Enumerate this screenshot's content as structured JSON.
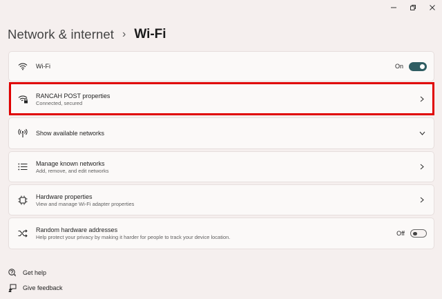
{
  "window": {
    "controls": {
      "minimize_icon": "minimize-icon",
      "restore_icon": "restore-icon",
      "close_icon": "close-icon"
    }
  },
  "breadcrumb": {
    "parent": "Network & internet",
    "separator": "›",
    "current": "Wi-Fi"
  },
  "rows": {
    "wifi": {
      "title": "Wi-Fi",
      "state": "On",
      "icon": "wifi-icon",
      "on": true
    },
    "properties": {
      "title": "RANCAH POST properties",
      "subtitle": "Connected, secured",
      "icon": "wifi-secured-icon"
    },
    "available": {
      "title": "Show available networks",
      "icon": "antenna-icon"
    },
    "known": {
      "title": "Manage known networks",
      "subtitle": "Add, remove, and edit networks",
      "icon": "list-icon"
    },
    "hardware": {
      "title": "Hardware properties",
      "subtitle": "View and manage Wi-Fi adapter properties",
      "icon": "chip-icon"
    },
    "random": {
      "title": "Random hardware addresses",
      "subtitle": "Help protect your privacy by making it harder for people to track your device location.",
      "state": "Off",
      "icon": "shuffle-icon",
      "on": false
    }
  },
  "help": {
    "get_help": "Get help",
    "give_feedback": "Give feedback"
  },
  "colors": {
    "background": "#f5efee",
    "card": "#fbf9f8",
    "toggle_on": "#2f5d62",
    "highlight": "#e00000"
  }
}
